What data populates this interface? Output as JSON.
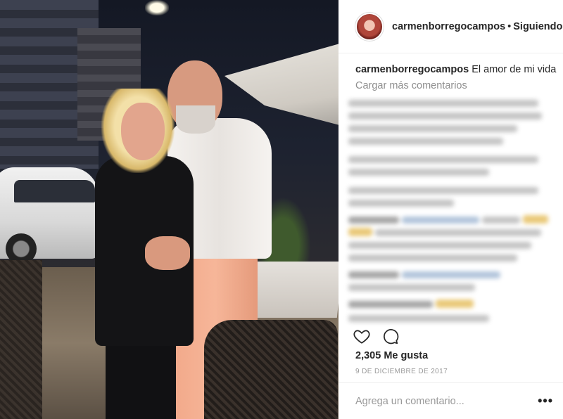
{
  "post": {
    "username": "carmenborregocampos",
    "follow_separator": "•",
    "follow_label": "Siguiendo",
    "caption_username": "carmenborregocampos",
    "caption_text": "El amor de mi vida",
    "load_more_label": "Cargar más comentarios",
    "likes_text": "2,305 Me gusta",
    "date_text": "9 DE DICIEMBRE DE 2017",
    "comment_placeholder": "Agrega un comentario...",
    "more_options_label": "•••"
  },
  "icons": {
    "like": "heart-icon",
    "comment": "comment-bubble-icon",
    "more": "more-options-icon"
  },
  "colors": {
    "text": "#262626",
    "muted": "#8e8e8e",
    "border": "#efefef"
  }
}
